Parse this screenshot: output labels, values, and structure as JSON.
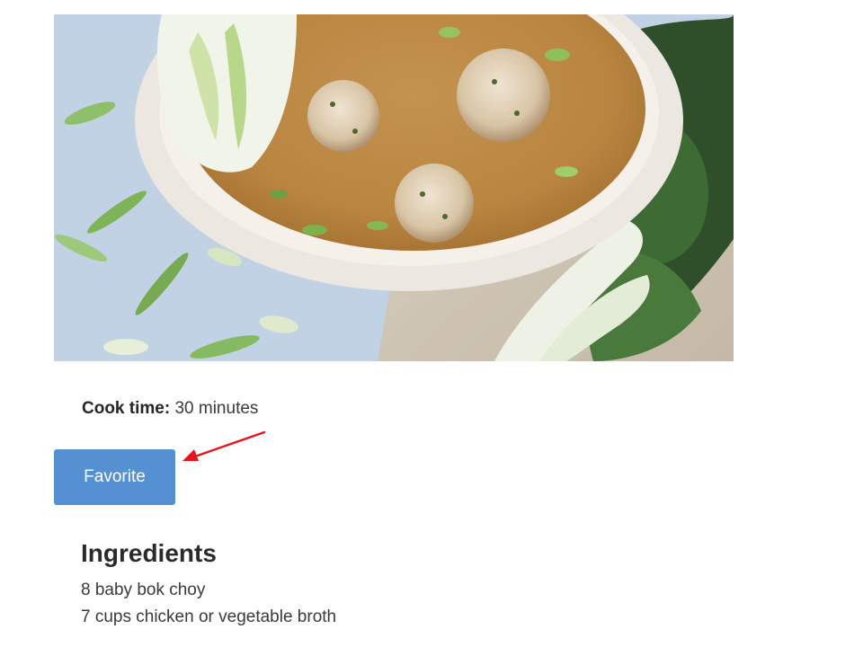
{
  "recipe": {
    "image_alt": "Meatball soup with baby bok choy",
    "cook_time_label": "Cook time:",
    "cook_time_value": "30 minutes",
    "favorite_label": "Favorite",
    "ingredients_title": "Ingredients",
    "ingredients": [
      "8 baby bok choy",
      "7 cups chicken or vegetable broth"
    ]
  },
  "colors": {
    "button": "#5590d3",
    "annotation_arrow": "#e8141b"
  },
  "icons": {
    "annotation": "arrow-icon"
  }
}
